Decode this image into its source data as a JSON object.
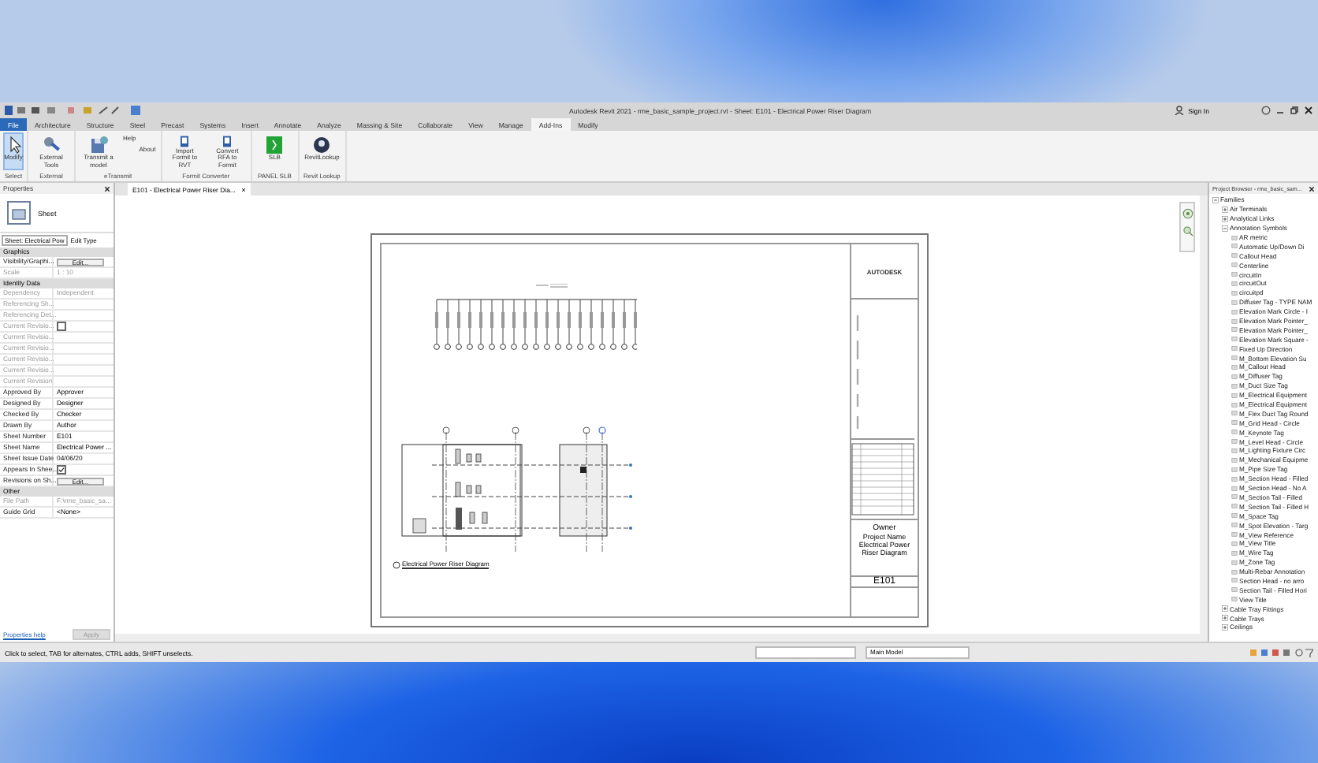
{
  "window": {
    "title": "Autodesk Revit 2021 - rme_basic_sample_project.rvt - Sheet: E101 - Electrical Power Riser Diagram",
    "sign_in": "Sign In"
  },
  "ribbon_tabs": [
    {
      "label": "File",
      "kind": "application",
      "selected": false
    },
    {
      "label": "Architecture",
      "kind": "tab",
      "selected": false
    },
    {
      "label": "Structure",
      "kind": "tab",
      "selected": false
    },
    {
      "label": "Steel",
      "kind": "tab",
      "selected": false
    },
    {
      "label": "Precast",
      "kind": "tab",
      "selected": false
    },
    {
      "label": "Systems",
      "kind": "tab",
      "selected": false
    },
    {
      "label": "Insert",
      "kind": "tab",
      "selected": false
    },
    {
      "label": "Annotate",
      "kind": "tab",
      "selected": false
    },
    {
      "label": "Analyze",
      "kind": "tab",
      "selected": false
    },
    {
      "label": "Massing & Site",
      "kind": "tab",
      "selected": false
    },
    {
      "label": "Collaborate",
      "kind": "tab",
      "selected": false
    },
    {
      "label": "View",
      "kind": "tab",
      "selected": false
    },
    {
      "label": "Manage",
      "kind": "tab",
      "selected": false
    },
    {
      "label": "Add-Ins",
      "kind": "tab",
      "selected": true
    },
    {
      "label": "Modify",
      "kind": "tab",
      "selected": false
    }
  ],
  "ribbon_panels": [
    {
      "title": "Select",
      "buttons": [
        {
          "label": "Modify",
          "kind": "large",
          "selected": true
        }
      ]
    },
    {
      "title": "External",
      "buttons": [
        {
          "label": "External Tools",
          "kind": "large",
          "selected": false
        }
      ]
    },
    {
      "title": "eTransmit",
      "buttons": [
        {
          "label": "Transmit a model",
          "kind": "large",
          "selected": false
        },
        {
          "label": "Help",
          "kind": "small",
          "selected": false
        },
        {
          "label": "About",
          "kind": "small",
          "selected": false
        }
      ]
    },
    {
      "title": "Formit Converter",
      "buttons": [
        {
          "label": "Import Formit to RVT",
          "kind": "large",
          "selected": false
        },
        {
          "label": "Convert RFA to Formit",
          "kind": "large",
          "selected": false
        }
      ]
    },
    {
      "title": "PANEL SLB",
      "buttons": [
        {
          "label": "SLB",
          "kind": "large",
          "selected": false
        }
      ]
    },
    {
      "title": "Revit Lookup",
      "buttons": [
        {
          "label": "RevitLookup",
          "kind": "large",
          "selected": false
        }
      ]
    }
  ],
  "properties": {
    "title": "Properties",
    "type_name": "Sheet",
    "instance_selector": "Sheet: Electrical Pow",
    "edit_type": "Edit Type",
    "groups": [
      {
        "name": "Graphics",
        "rows": [
          {
            "name": "Visibility/Graphi...",
            "kind": "button",
            "value": "Edit...",
            "disabled": false
          },
          {
            "name": "Scale",
            "kind": "text",
            "value": "1 : 10",
            "disabled": true
          }
        ]
      },
      {
        "name": "Identity Data",
        "rows": [
          {
            "name": "Dependency",
            "kind": "text",
            "value": "Independent",
            "disabled": true
          },
          {
            "name": "Referencing Sh...",
            "kind": "text",
            "value": "",
            "disabled": true
          },
          {
            "name": "Referencing Det...",
            "kind": "text",
            "value": "",
            "disabled": true
          },
          {
            "name": "Current Revisio...",
            "kind": "checkbox",
            "checked": false,
            "disabled": true
          },
          {
            "name": "Current Revisio...",
            "kind": "text",
            "value": "",
            "disabled": true
          },
          {
            "name": "Current Revisio...",
            "kind": "text",
            "value": "",
            "disabled": true
          },
          {
            "name": "Current Revisio...",
            "kind": "text",
            "value": "",
            "disabled": true
          },
          {
            "name": "Current Revisio...",
            "kind": "text",
            "value": "",
            "disabled": true
          },
          {
            "name": "Current Revision",
            "kind": "text",
            "value": "",
            "disabled": true
          },
          {
            "name": "Approved By",
            "kind": "text",
            "value": "Approver",
            "disabled": false
          },
          {
            "name": "Designed By",
            "kind": "text",
            "value": "Designer",
            "disabled": false
          },
          {
            "name": "Checked By",
            "kind": "text",
            "value": "Checker",
            "disabled": false
          },
          {
            "name": "Drawn By",
            "kind": "text",
            "value": "Author",
            "disabled": false
          },
          {
            "name": "Sheet Number",
            "kind": "text",
            "value": "E101",
            "disabled": false
          },
          {
            "name": "Sheet Name",
            "kind": "text",
            "value": "Electrical Power ...",
            "disabled": false
          },
          {
            "name": "Sheet Issue Date",
            "kind": "text",
            "value": "04/06/20",
            "disabled": false
          },
          {
            "name": "Appears In Shee...",
            "kind": "checkbox",
            "checked": true,
            "disabled": false
          },
          {
            "name": "Revisions on Sh...",
            "kind": "button",
            "value": "Edit...",
            "disabled": false
          }
        ]
      },
      {
        "name": "Other",
        "rows": [
          {
            "name": "File Path",
            "kind": "text",
            "value": "F:\\rme_basic_sa...",
            "disabled": true
          },
          {
            "name": "Guide Grid",
            "kind": "text",
            "value": "<None>",
            "disabled": false
          }
        ]
      }
    ],
    "help_link": "Properties help",
    "apply": {
      "label": "Apply",
      "disabled": true
    }
  },
  "view_tab": {
    "label": "E101 - Electrical Power Riser Dia..."
  },
  "sheet": {
    "logo": "AUTODESK",
    "owner": "Owner",
    "project_name": "Project Name",
    "sheet_name": "Electrical Power Riser Diagram",
    "sheet_number": "E101",
    "view_title": "Electrical Power Riser Diagram"
  },
  "browser": {
    "title": "Project Browser - rme_basic_sam...",
    "tree": [
      {
        "label": "Families",
        "expanded": true,
        "children": [
          {
            "label": "Air Terminals",
            "expanded": false
          },
          {
            "label": "Analytical Links",
            "expanded": false
          },
          {
            "label": "Annotation Symbols",
            "expanded": true,
            "children": [
              {
                "label": "AR metric"
              },
              {
                "label": "Automatic Up/Down Di"
              },
              {
                "label": "Callout Head"
              },
              {
                "label": "Centerline"
              },
              {
                "label": "circuitIn"
              },
              {
                "label": "circuitOut"
              },
              {
                "label": "circuitpd"
              },
              {
                "label": "Diffuser Tag - TYPE NAM"
              },
              {
                "label": "Elevation Mark Circle - I"
              },
              {
                "label": "Elevation Mark Pointer_"
              },
              {
                "label": "Elevation Mark Pointer_"
              },
              {
                "label": "Elevation Mark Square -"
              },
              {
                "label": "Fixed Up Direction"
              },
              {
                "label": "M_Bottom Elevation Su"
              },
              {
                "label": "M_Callout Head"
              },
              {
                "label": "M_Diffuser Tag"
              },
              {
                "label": "M_Duct Size Tag"
              },
              {
                "label": "M_Electrical Equipment"
              },
              {
                "label": "M_Electrical Equipment"
              },
              {
                "label": "M_Flex Duct Tag Round"
              },
              {
                "label": "M_Grid Head - Circle"
              },
              {
                "label": "M_Keynote Tag"
              },
              {
                "label": "M_Level Head - Circle"
              },
              {
                "label": "M_Lighting Fixture Circ"
              },
              {
                "label": "M_Mechanical Equipme"
              },
              {
                "label": "M_Pipe Size Tag"
              },
              {
                "label": "M_Section Head - Filled"
              },
              {
                "label": "M_Section Head - No A"
              },
              {
                "label": "M_Section Tail - Filled"
              },
              {
                "label": "M_Section Tail - Filled H"
              },
              {
                "label": "M_Space Tag"
              },
              {
                "label": "M_Spot Elevation - Targ"
              },
              {
                "label": "M_View Reference"
              },
              {
                "label": "M_View Title"
              },
              {
                "label": "M_Wire Tag"
              },
              {
                "label": "M_Zone Tag"
              },
              {
                "label": "Multi-Rebar Annotation"
              },
              {
                "label": "Section Head - no arro"
              },
              {
                "label": "Section Tail - Filled Hori"
              },
              {
                "label": "View Title"
              }
            ]
          },
          {
            "label": "Cable Tray Fittings",
            "expanded": false
          },
          {
            "label": "Cable Trays",
            "expanded": false
          },
          {
            "label": "Ceilings",
            "expanded": false
          }
        ]
      }
    ]
  },
  "status_bar": {
    "message": "Click to select, TAB for alternates, CTRL adds, SHIFT unselects.",
    "model": "Main Model"
  }
}
